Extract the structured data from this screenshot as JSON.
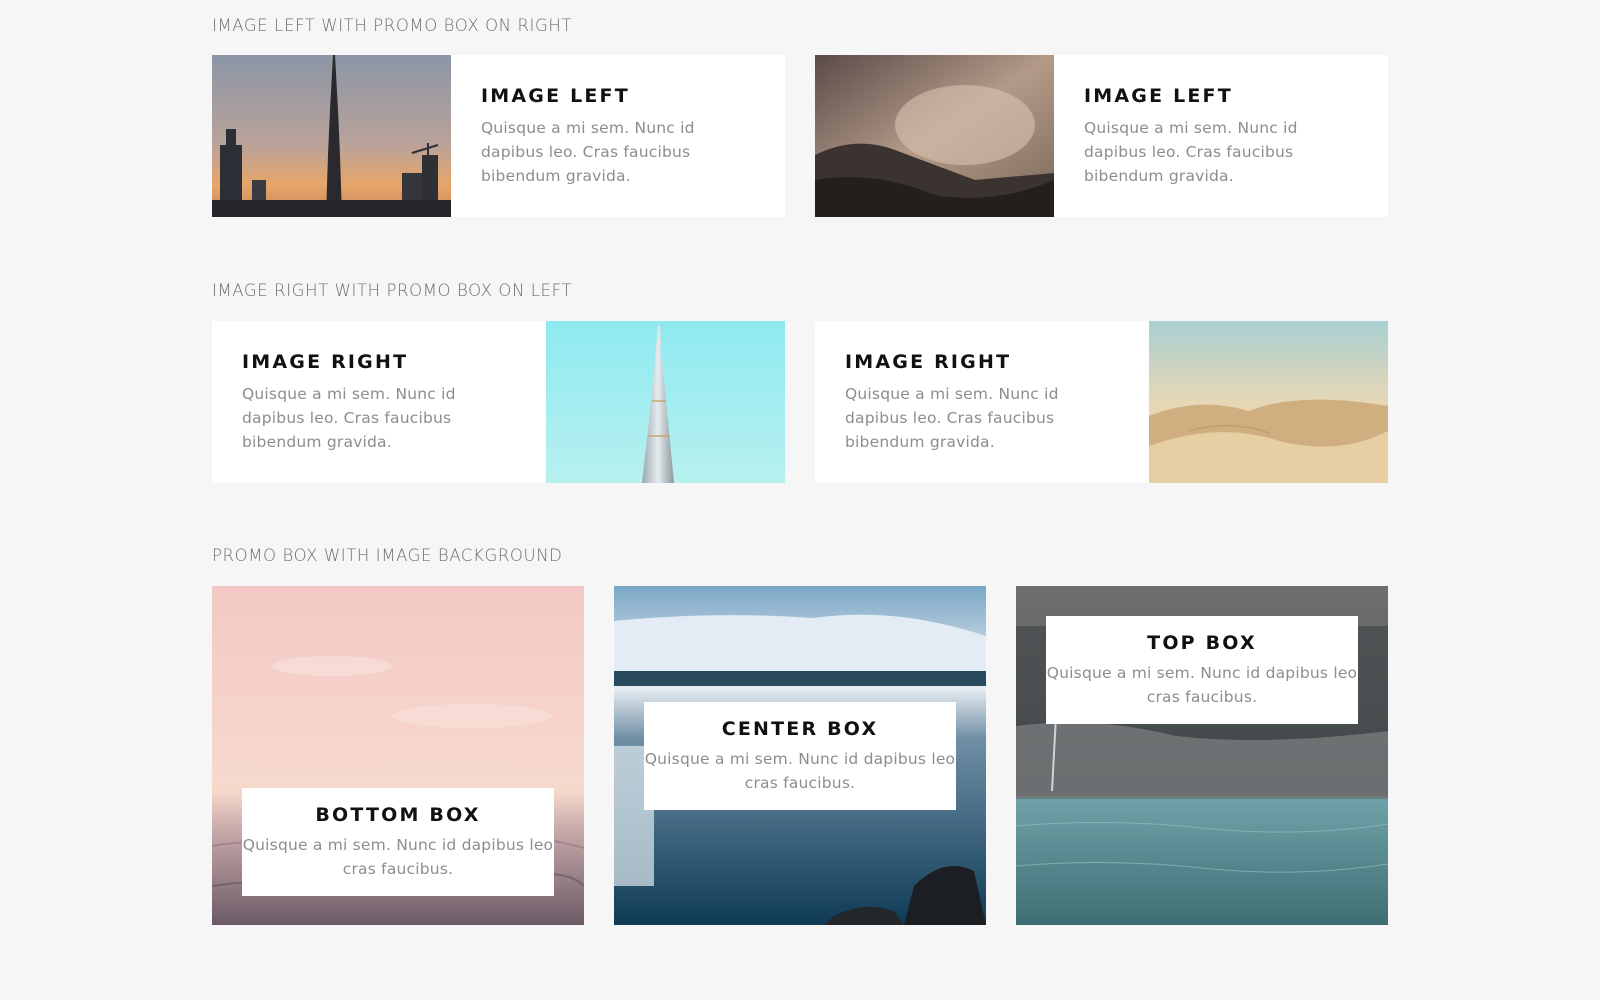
{
  "sections": {
    "image_left": {
      "label": "IMAGE LEFT WITH PROMO BOX ON RIGHT"
    },
    "image_right": {
      "label": "IMAGE RIGHT WITH PROMO BOX ON LEFT"
    },
    "image_bg": {
      "label": "PROMO BOX WITH IMAGE BACKGROUND"
    }
  },
  "promos_left": [
    {
      "title": "IMAGE LEFT",
      "body": "Quisque a mi sem. Nunc id dapibus leo. Cras faucibus bibendum gravida.",
      "image": "city-skyline-sunset"
    },
    {
      "title": "IMAGE LEFT",
      "body": "Quisque a mi sem. Nunc id dapibus leo. Cras faucibus bibendum gravida.",
      "image": "misty-mountains"
    }
  ],
  "promos_right": [
    {
      "title": "IMAGE RIGHT",
      "body": "Quisque a mi sem. Nunc id dapibus leo. Cras faucibus bibendum gravida.",
      "image": "tower-blue-sky"
    },
    {
      "title": "IMAGE RIGHT",
      "body": "Quisque a mi sem. Nunc id dapibus leo. Cras faucibus bibendum gravida.",
      "image": "desert-dunes"
    }
  ],
  "tiles": [
    {
      "title": "BOTTOM BOX",
      "body": "Quisque a mi sem. Nunc id dapibus leo cras faucibus.",
      "image": "pink-sea-sunset"
    },
    {
      "title": "CENTER BOX",
      "body": "Quisque a mi sem. Nunc id dapibus leo cras faucibus.",
      "image": "glacier-waterfall"
    },
    {
      "title": "TOP BOX",
      "body": "Quisque a mi sem. Nunc id dapibus leo cras faucibus.",
      "image": "cliff-lake"
    }
  ],
  "colors": {
    "page_background": "#f6f6f6",
    "card_background": "#ffffff",
    "heading": "#111111",
    "body_text": "#8d8d8d",
    "section_label": "#6d6d6d"
  }
}
